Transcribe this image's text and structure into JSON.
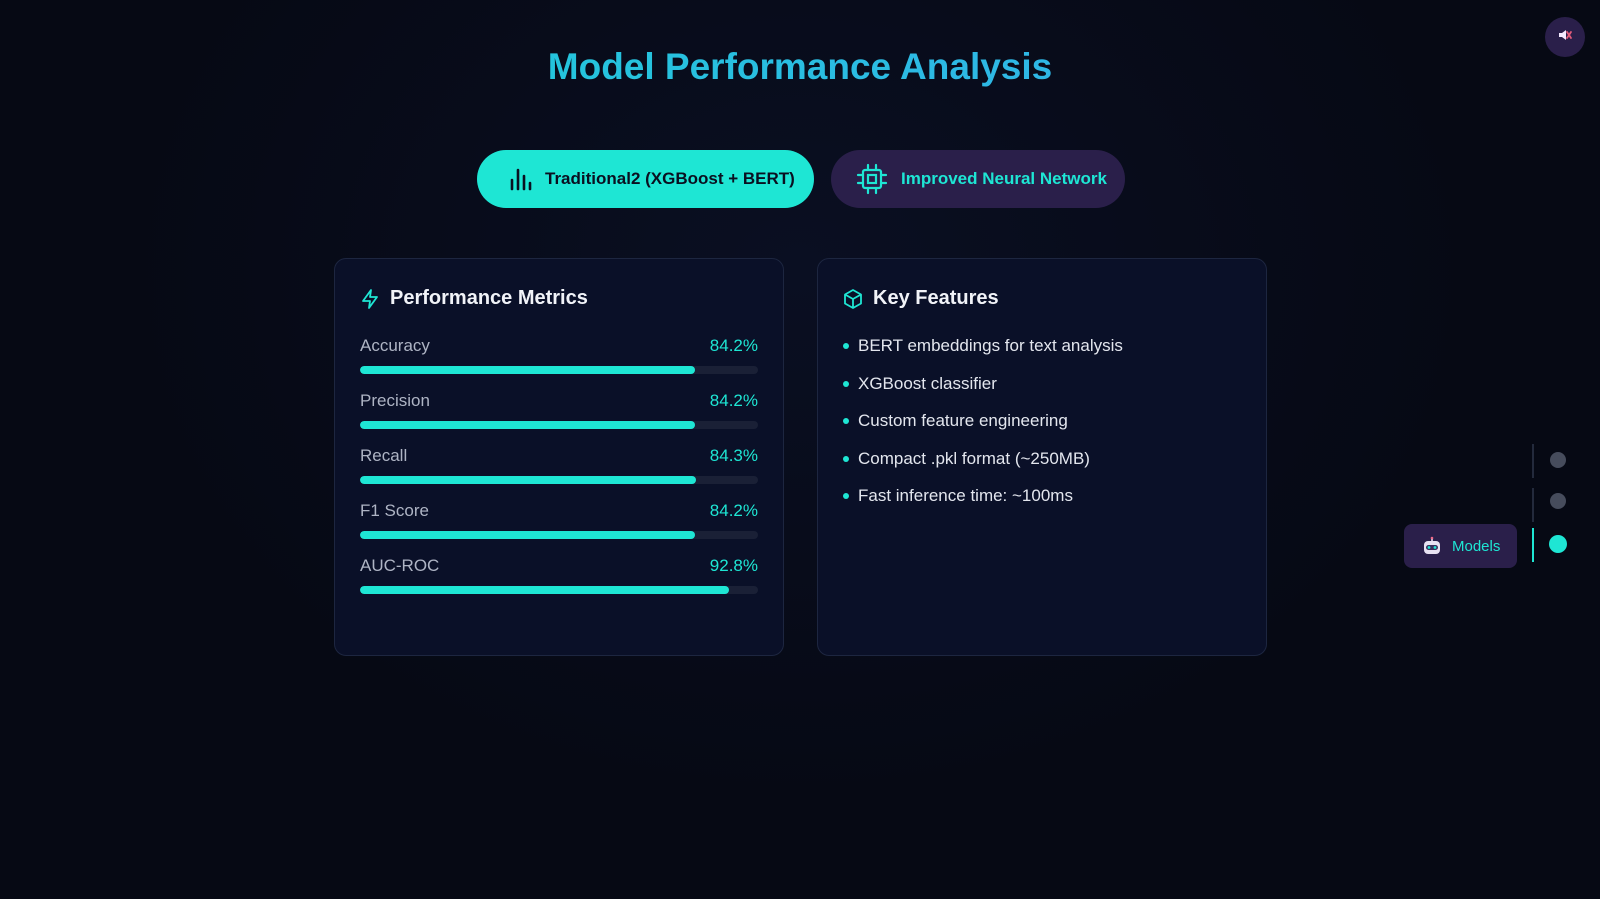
{
  "page": {
    "title": "Model Performance Analysis"
  },
  "header": {
    "sound_toggle_icon": "speaker-muted-icon"
  },
  "tabs": [
    {
      "label": "Traditional2 (XGBoost + BERT)",
      "icon": "bar-chart-icon",
      "active": true
    },
    {
      "label": "Improved Neural Network",
      "icon": "cpu-chip-icon",
      "active": false
    }
  ],
  "metrics_card": {
    "title": "Performance Metrics",
    "icon": "lightning-bolt-icon",
    "metrics": [
      {
        "label": "Accuracy",
        "value": "84.2%",
        "fraction": 0.842
      },
      {
        "label": "Precision",
        "value": "84.2%",
        "fraction": 0.842
      },
      {
        "label": "Recall",
        "value": "84.3%",
        "fraction": 0.843
      },
      {
        "label": "F1 Score",
        "value": "84.2%",
        "fraction": 0.842
      },
      {
        "label": "AUC-ROC",
        "value": "92.8%",
        "fraction": 0.928
      }
    ]
  },
  "features_card": {
    "title": "Key Features",
    "icon": "cube-icon",
    "items": [
      "BERT embeddings for text analysis",
      "XGBoost classifier",
      "Custom feature engineering",
      "Compact .pkl format (~250MB)",
      "Fast inference time: ~100ms"
    ]
  },
  "side_nav": {
    "active_label": "Models",
    "active_icon": "robot-icon",
    "active_index": 2,
    "count": 3
  },
  "colors": {
    "accent": "#1ee6d4",
    "background": "#060914",
    "card": "#0a1028",
    "purple": "#2a1f4a"
  }
}
